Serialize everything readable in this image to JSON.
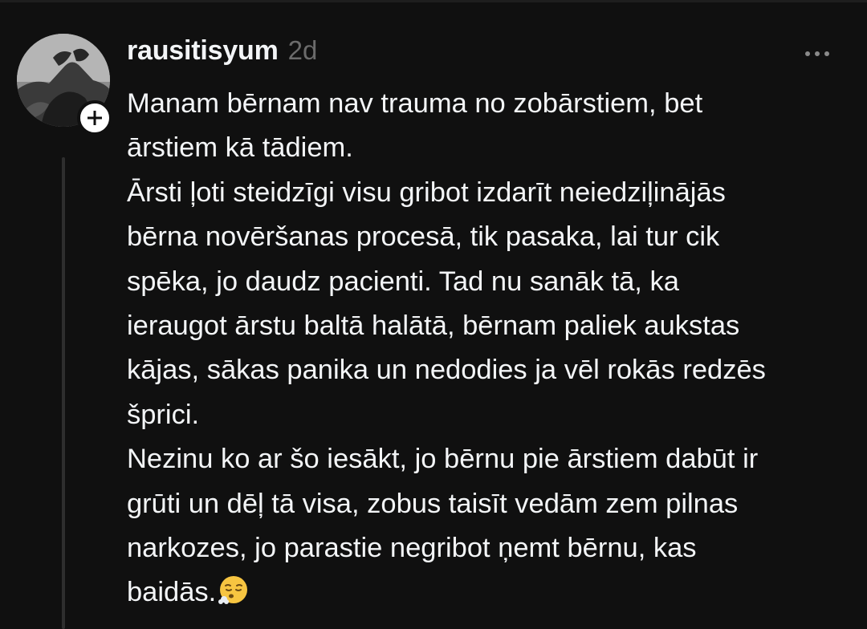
{
  "post": {
    "username": "rausitisyum",
    "timestamp": "2d",
    "lines": [
      "Manam bērnam nav trauma no zobārstiem, bet",
      "ārstiem kā tādiem.",
      "Ārsti ļoti steidzīgi visu gribot izdarīt neiedziļinājās",
      "bērna novēršanas procesā, tik pasaka, lai tur cik",
      "spēka, jo daudz pacienti. Tad nu sanāk tā, ka",
      "ieraugot ārstu baltā halātā, bērnam paliek aukstas",
      "kājas, sākas panika un nedodies ja vēl rokās redzēs",
      "šprici.",
      "Nezinu ko ar šo iesākt, jo bērnu pie ārstiem dabūt ir",
      "grūti un dēļ tā visa, zobus taisīt vedām zem pilnas",
      "narkozes, jo parastie negribot ņemt bērnu, kas",
      "baidās."
    ],
    "trailing_emoji": "face-exhaling-emoji"
  },
  "icons": {
    "follow": "plus-icon",
    "more": "more-options-icon"
  },
  "colors": {
    "background": "#101010",
    "text": "#f3f5f7",
    "muted": "#6b6b6b",
    "thread_line": "#2e2e2e"
  }
}
